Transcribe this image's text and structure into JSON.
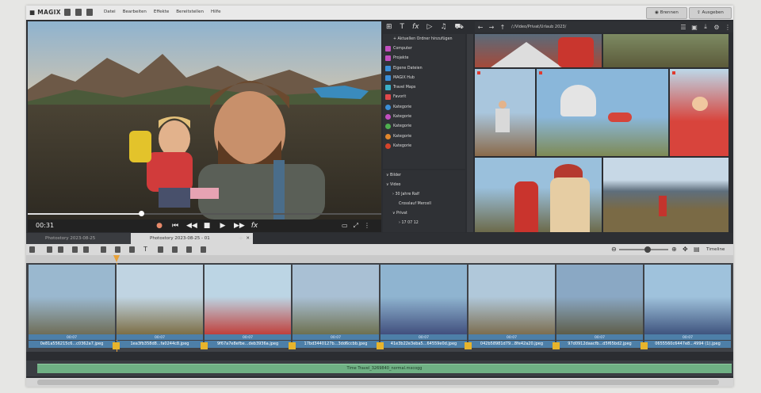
{
  "app": {
    "logo": "■ MAGIX",
    "menu": [
      "Datei",
      "Bearbeiten",
      "Effekte",
      "Bereitstellen",
      "Hilfe"
    ],
    "burn_label": "Brennen",
    "export_label": "Ausgeben"
  },
  "player": {
    "timecode": "00:31",
    "buttons": [
      "●",
      "⏮",
      "◀◀",
      "■",
      "▶",
      "▶▶",
      "fx"
    ],
    "progress": 0.32
  },
  "media_pool": {
    "header_icons": [
      "⊞",
      "T",
      "fx",
      "▷",
      "♫",
      "⛟"
    ],
    "sources": [
      {
        "label": "+  Aktuellen Ordner hinzufügen",
        "icon": "plus-icon",
        "color": "#303236"
      },
      {
        "label": "Computer",
        "icon": "computer-icon",
        "color": "#c14fbf"
      },
      {
        "label": "Projekte",
        "icon": "projects-icon",
        "color": "#c14fbf"
      },
      {
        "label": "Eigene Dateien",
        "icon": "my-files-icon",
        "color": "#3b8fd8"
      },
      {
        "label": "MAGIX Hub",
        "icon": "magix-hub-icon",
        "color": "#3b8fd8"
      },
      {
        "label": "Travel Maps",
        "icon": "travel-maps-icon",
        "color": "#3bb0c8"
      },
      {
        "label": "Favorit",
        "icon": "heart-icon",
        "color": "#e0484a"
      },
      {
        "label": "Kategorie",
        "icon": "category-dot-icon",
        "color": "#3b8fd8"
      },
      {
        "label": "Kategorie",
        "icon": "category-dot-icon",
        "color": "#c14fbf"
      },
      {
        "label": "Kategorie",
        "icon": "category-dot-icon",
        "color": "#4fb04f"
      },
      {
        "label": "Kategorie",
        "icon": "category-dot-icon",
        "color": "#e0862c"
      },
      {
        "label": "Kategorie",
        "icon": "category-dot-icon",
        "color": "#d4432a"
      }
    ],
    "tree": [
      {
        "label": "∨  Bilder",
        "indent": 0
      },
      {
        "label": "∨  Video",
        "indent": 0
      },
      {
        "label": "›  30 Jahre Ralf",
        "indent": 1
      },
      {
        "label": "Crosslauf Mercell",
        "indent": 2
      },
      {
        "label": "∨  Privat",
        "indent": 1
      },
      {
        "label": "›  17 07 12",
        "indent": 2
      }
    ],
    "path": "/:/Video/Privat/Urlaub 2023/"
  },
  "tabs": [
    {
      "label": "Photostory 2023-08-25",
      "active": false
    },
    {
      "label": "Photostory 2023-08-25 - 01",
      "active": true
    }
  ],
  "timeline": {
    "label": "Timeline",
    "clips": [
      {
        "duration": "00:07",
        "name": "0e81a556215c6...c0362a7.jpeg"
      },
      {
        "duration": "00:07",
        "name": "1ea3fb358d8...fa0244c8.jpeg"
      },
      {
        "duration": "00:07",
        "name": "9f67a7e8efbe...deb3936a.jpeg"
      },
      {
        "duration": "00:07",
        "name": "17bd3440127b...3dd6ccbb.jpeg"
      },
      {
        "duration": "00:07",
        "name": "41e3b22e3eba5...64559e0d.jpeg"
      },
      {
        "duration": "00:07",
        "name": "042b58981d79...8fe42a20.jpeg"
      },
      {
        "duration": "00:07",
        "name": "97d0912daacfb...d5f65bd2.jpeg"
      },
      {
        "duration": "00:07",
        "name": "0655560c6447e8...4994 (1).jpeg"
      }
    ],
    "audio_name": "Time Travel_3269840_normal.mxcogg"
  },
  "colors": {
    "accent_orange": "#e8a23a",
    "clip_blue": "#4d7fa8",
    "audio_green": "#6fb084"
  }
}
